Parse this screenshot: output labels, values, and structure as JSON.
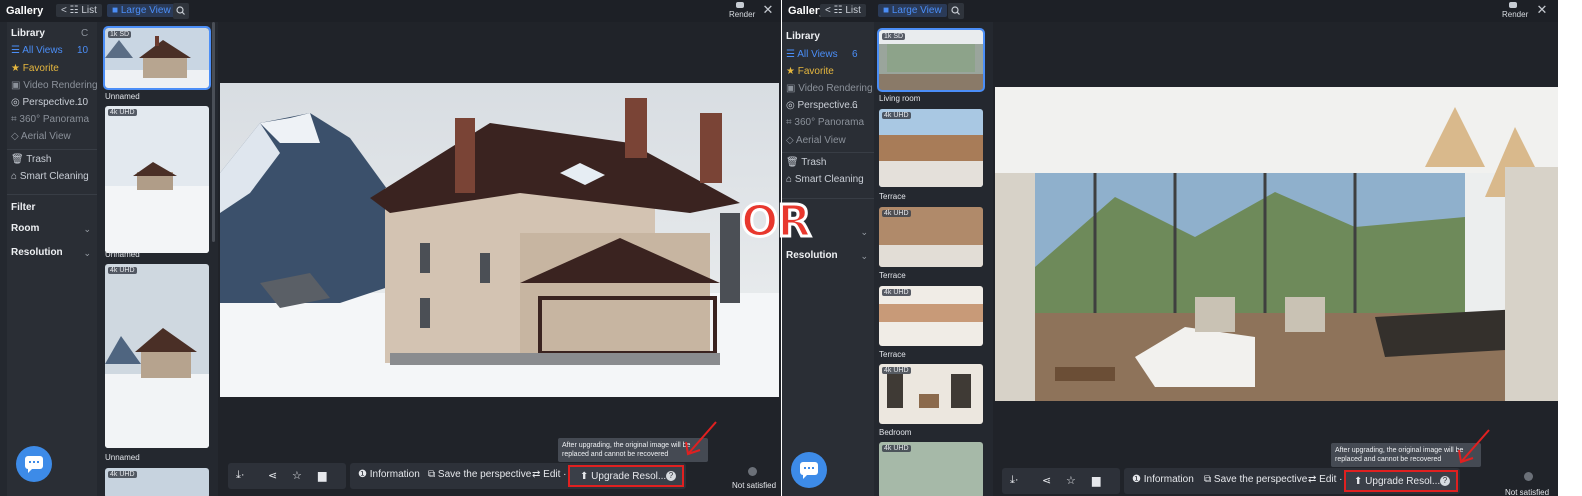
{
  "left": {
    "topbar": {
      "gallery": "Gallery",
      "list": "< ☷ List",
      "large_view": "■ Large View",
      "render": "Render"
    },
    "sidebar": {
      "library": "Library",
      "refresh": "C",
      "items": [
        {
          "label": "☰ All Views",
          "count": "10"
        },
        {
          "label": "★ Favorite",
          "count": ""
        },
        {
          "label": "▣ Video Rendering",
          "count": ""
        },
        {
          "label": "◎ Perspective...",
          "count": "10"
        },
        {
          "label": "⌗ 360° Panorama",
          "count": ""
        },
        {
          "label": "◇ Aerial View",
          "count": ""
        },
        {
          "label": "🗑 Trash",
          "count": ""
        },
        {
          "label": "⌂ Smart Cleaning",
          "count": ""
        }
      ],
      "filter": "Filter",
      "room": "Room",
      "resolution": "Resolution"
    },
    "thumbs": [
      {
        "badge": "1k SD",
        "label": "Unnamed"
      },
      {
        "badge": "4k UHD",
        "label": "Unnamed"
      },
      {
        "badge": "4k UHD",
        "label": "Unnamed"
      },
      {
        "badge": "4k UHD",
        "label": ""
      }
    ],
    "bottom": {
      "information": "❶ Information",
      "save_perspective": "⧉ Save the perspective",
      "edit": "⇄ Edit ·",
      "upgrade": "⬆ Upgrade Resol...",
      "help": "?",
      "tooltip": "After upgrading, the original image will be replaced and cannot be recovered",
      "not_satisfied": "Not satisfied"
    }
  },
  "right": {
    "topbar": {
      "gallery": "Gallery",
      "list": "< ☷ List",
      "large_view": "■ Large View",
      "render": "Render"
    },
    "sidebar": {
      "library": "Library",
      "items": [
        {
          "label": "☰ All Views",
          "count": "6"
        },
        {
          "label": "★ Favorite",
          "count": ""
        },
        {
          "label": "▣ Video Rendering",
          "count": ""
        },
        {
          "label": "◎ Perspective...",
          "count": "6"
        },
        {
          "label": "⌗ 360° Panorama",
          "count": ""
        },
        {
          "label": "◇ Aerial View",
          "count": ""
        },
        {
          "label": "🗑 Trash",
          "count": ""
        },
        {
          "label": "⌂ Smart Cleaning",
          "count": ""
        }
      ],
      "resolution": "Resolution"
    },
    "thumbs": [
      {
        "badge": "1k SD",
        "label": "Living room"
      },
      {
        "badge": "4k UHD",
        "label": "Terrace"
      },
      {
        "badge": "4k UHD",
        "label": "Terrace"
      },
      {
        "badge": "4k UHD",
        "label": "Terrace"
      },
      {
        "badge": "4k UHD",
        "label": "Bedroom"
      },
      {
        "badge": "4k UHD",
        "label": ""
      }
    ],
    "bottom": {
      "information": "❶ Information",
      "save_perspective": "⧉ Save the perspective",
      "edit": "⇄ Edit ·",
      "upgrade": "⬆ Upgrade Resol...",
      "help": "?",
      "tooltip": "After upgrading, the original image will be replaced and cannot be recovered",
      "not_satisfied": "Not satisfied"
    }
  },
  "or_label": "OR",
  "colors": {
    "accent": "#4b8ef7",
    "highlight": "#e02020",
    "bg": "#24282f"
  }
}
